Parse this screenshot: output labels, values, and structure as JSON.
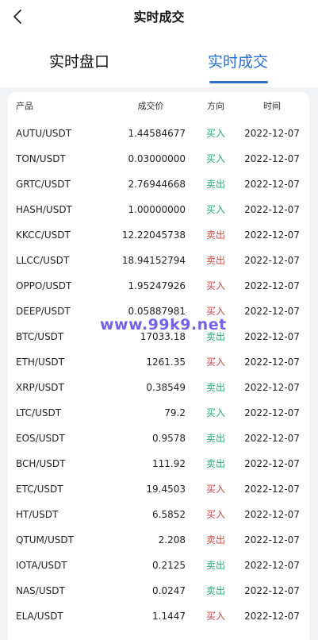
{
  "header": {
    "title": "实时成交"
  },
  "tabs": [
    {
      "label": "实时盘口",
      "active": false
    },
    {
      "label": "实时成交",
      "active": true
    }
  ],
  "colors": {
    "accent": "#2b6fd0",
    "buy": "#2aa87a",
    "sell": "#c94a4a"
  },
  "table": {
    "columns": [
      "产品",
      "成交价",
      "方向",
      "时间"
    ],
    "rows": [
      {
        "product": "AUTU/USDT",
        "price": "1.44584677",
        "direction": "买入",
        "side": "buy",
        "time": "2022-12-07"
      },
      {
        "product": "TON/USDT",
        "price": "0.03000000",
        "direction": "买入",
        "side": "buy",
        "time": "2022-12-07"
      },
      {
        "product": "GRTC/USDT",
        "price": "2.76944668",
        "direction": "卖出",
        "side": "buy",
        "time": "2022-12-07"
      },
      {
        "product": "HASH/USDT",
        "price": "1.00000000",
        "direction": "买入",
        "side": "buy",
        "time": "2022-12-07"
      },
      {
        "product": "KKCC/USDT",
        "price": "12.22045738",
        "direction": "卖出",
        "side": "sell",
        "time": "2022-12-07"
      },
      {
        "product": "LLCC/USDT",
        "price": "18.94152794",
        "direction": "卖出",
        "side": "sell",
        "time": "2022-12-07"
      },
      {
        "product": "OPPO/USDT",
        "price": "1.95247926",
        "direction": "买入",
        "side": "sell",
        "time": "2022-12-07"
      },
      {
        "product": "DEEP/USDT",
        "price": "0.05887981",
        "direction": "买入",
        "side": "sell",
        "time": "2022-12-07"
      },
      {
        "product": "BTC/USDT",
        "price": "17033.18",
        "direction": "卖出",
        "side": "buy",
        "time": "2022-12-07"
      },
      {
        "product": "ETH/USDT",
        "price": "1261.35",
        "direction": "买入",
        "side": "sell",
        "time": "2022-12-07"
      },
      {
        "product": "XRP/USDT",
        "price": "0.38549",
        "direction": "卖出",
        "side": "buy",
        "time": "2022-12-07"
      },
      {
        "product": "LTC/USDT",
        "price": "79.2",
        "direction": "买入",
        "side": "buy",
        "time": "2022-12-07"
      },
      {
        "product": "EOS/USDT",
        "price": "0.9578",
        "direction": "卖出",
        "side": "buy",
        "time": "2022-12-07"
      },
      {
        "product": "BCH/USDT",
        "price": "111.92",
        "direction": "卖出",
        "side": "buy",
        "time": "2022-12-07"
      },
      {
        "product": "ETC/USDT",
        "price": "19.4503",
        "direction": "买入",
        "side": "sell",
        "time": "2022-12-07"
      },
      {
        "product": "HT/USDT",
        "price": "6.5852",
        "direction": "买入",
        "side": "sell",
        "time": "2022-12-07"
      },
      {
        "product": "QTUM/USDT",
        "price": "2.208",
        "direction": "卖出",
        "side": "sell",
        "time": "2022-12-07"
      },
      {
        "product": "IOTA/USDT",
        "price": "0.2125",
        "direction": "卖出",
        "side": "buy",
        "time": "2022-12-07"
      },
      {
        "product": "NAS/USDT",
        "price": "0.0247",
        "direction": "卖出",
        "side": "buy",
        "time": "2022-12-07"
      },
      {
        "product": "ELA/USDT",
        "price": "1.1447",
        "direction": "买入",
        "side": "sell",
        "time": "2022-12-07"
      }
    ]
  },
  "watermark": "www.99k9.net"
}
